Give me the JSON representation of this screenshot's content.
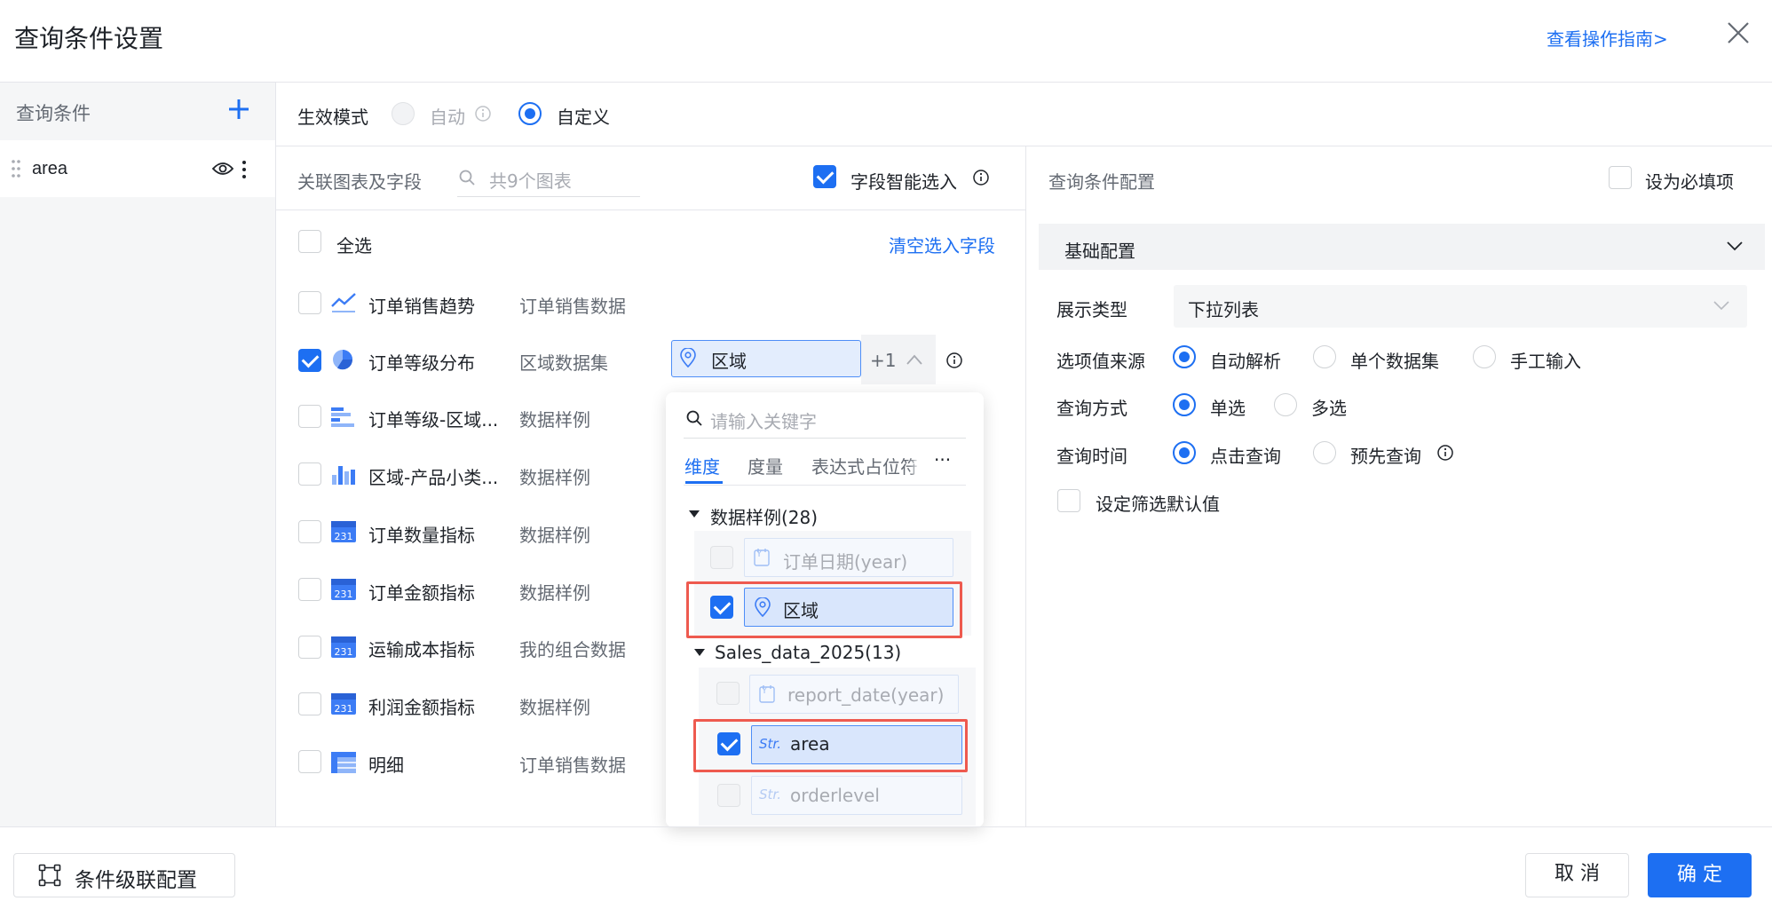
{
  "dialog": {
    "title": "查询条件设置",
    "guide_link": "查看操作指南>"
  },
  "sidebar": {
    "header": "查询条件",
    "items": [
      {
        "label": "area"
      }
    ]
  },
  "mode": {
    "label": "生效模式",
    "options": [
      {
        "label": "自动",
        "selected": false,
        "disabled": true
      },
      {
        "label": "自定义",
        "selected": true,
        "disabled": false
      }
    ]
  },
  "charts_panel": {
    "label": "关联图表及字段",
    "search_placeholder": "共9个图表",
    "smart_select_label": "字段智能选入",
    "smart_select_checked": true,
    "select_all_label": "全选",
    "clear_link": "清空选入字段",
    "charts": [
      {
        "name": "订单销售趋势",
        "dataset": "订单销售数据",
        "checked": false,
        "icon": "line-chart-icon"
      },
      {
        "name": "订单等级分布",
        "dataset": "区域数据集",
        "checked": true,
        "icon": "pie-chart-icon"
      },
      {
        "name": "订单等级-区域...",
        "dataset": "数据样例",
        "checked": false,
        "icon": "bar-chart-horizontal-icon"
      },
      {
        "name": "区域-产品小类...",
        "dataset": "数据样例",
        "checked": false,
        "icon": "bar-chart-vertical-icon"
      },
      {
        "name": "订单数量指标",
        "dataset": "数据样例",
        "checked": false,
        "icon": "kpi-icon"
      },
      {
        "name": "订单金额指标",
        "dataset": "数据样例",
        "checked": false,
        "icon": "kpi-icon"
      },
      {
        "name": "运输成本指标",
        "dataset": "我的组合数据",
        "checked": false,
        "icon": "kpi-icon"
      },
      {
        "name": "利润金额指标",
        "dataset": "数据样例",
        "checked": false,
        "icon": "kpi-icon"
      },
      {
        "name": "明细",
        "dataset": "订单销售数据",
        "checked": false,
        "icon": "table-icon"
      }
    ],
    "selected_field": {
      "label": "区域",
      "extra": "+1"
    }
  },
  "field_popup": {
    "search_placeholder": "请输入关键字",
    "tabs": [
      "维度",
      "度量",
      "表达式占位符"
    ],
    "more": "···",
    "groups": [
      {
        "name": "数据样例(28)",
        "fields": [
          {
            "label": "订单日期(year)",
            "type": "date",
            "checked": false,
            "disabled": true
          },
          {
            "label": "区域",
            "type": "geo",
            "checked": true,
            "disabled": false
          }
        ]
      },
      {
        "name": "Sales_data_2025(13)",
        "fields": [
          {
            "label": "report_date(year)",
            "type": "date",
            "checked": false,
            "disabled": true
          },
          {
            "label": "area",
            "type": "str",
            "checked": true,
            "disabled": false
          },
          {
            "label": "orderlevel",
            "type": "str",
            "checked": false,
            "disabled": true
          }
        ]
      }
    ],
    "date_type_glyph": "Y",
    "str_type_glyph": "Str."
  },
  "config_panel": {
    "title": "查询条件配置",
    "required_label": "设为必填项",
    "section_title": "基础配置",
    "display_type_label": "展示类型",
    "display_type_value": "下拉列表",
    "source_label": "选项值来源",
    "source_options": [
      {
        "label": "自动解析",
        "selected": true
      },
      {
        "label": "单个数据集",
        "selected": false
      },
      {
        "label": "手工输入",
        "selected": false
      }
    ],
    "query_mode_label": "查询方式",
    "query_mode_options": [
      {
        "label": "单选",
        "selected": true
      },
      {
        "label": "多选",
        "selected": false
      }
    ],
    "query_time_label": "查询时间",
    "query_time_options": [
      {
        "label": "点击查询",
        "selected": true
      },
      {
        "label": "预先查询",
        "selected": false
      }
    ],
    "default_value_label": "设定筛选默认值"
  },
  "footer": {
    "cascade_button": "条件级联配置",
    "cancel_button": "取 消",
    "confirm_button": "确 定"
  },
  "colors": {
    "accent": "#1d6ff2",
    "highlight_border": "#ee5a4f"
  }
}
